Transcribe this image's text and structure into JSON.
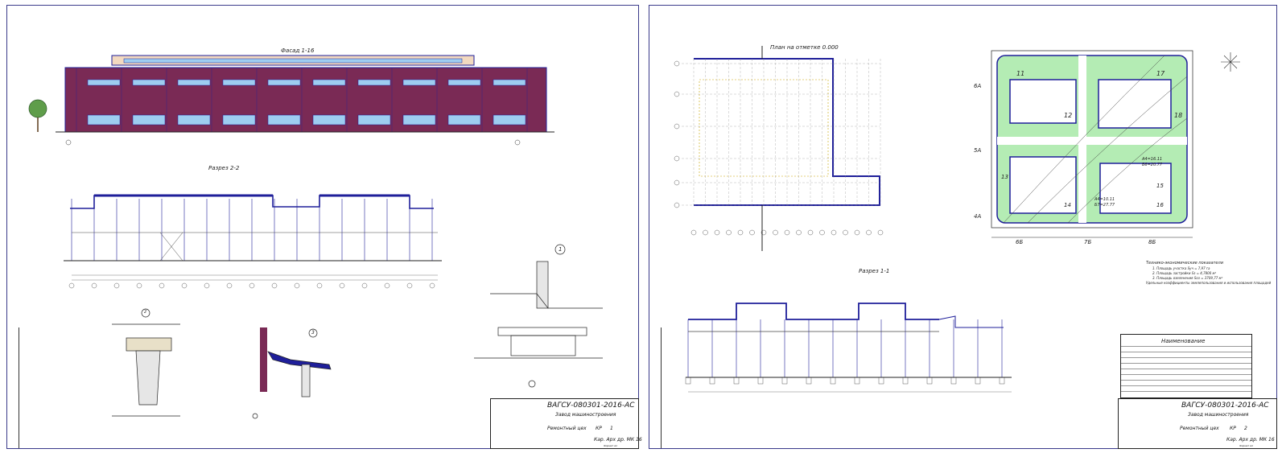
{
  "sheet1": {
    "facade_title": "Фасад 1-16",
    "section_title": "Разрез 2-2",
    "node_labels": [
      "1",
      "2",
      "3"
    ],
    "title_block": {
      "code": "ВАГСУ-080301-2016-АС",
      "project": "Завод машиностроения",
      "name": "Ремонтный цех",
      "stage": "КР",
      "sheet": "1",
      "sheets": "",
      "org": "Кар. Арх др. МК 16",
      "format": "Формат А1"
    }
  },
  "sheet2": {
    "plan_title": "План на отметке 0.000",
    "section_title": "Разрез 1-1",
    "site": {
      "dims": [
        "6Б",
        "7Б",
        "8Б"
      ],
      "axes": [
        "6А",
        "5А",
        "4А"
      ],
      "buildings": [
        "11",
        "17",
        "12",
        "18",
        "13",
        "14",
        "15",
        "16"
      ],
      "marks": [
        "А4=16.11",
        "Б6=20.77",
        "А4=10.11",
        "Б7=27.77"
      ]
    },
    "tep": {
      "title": "Технико-экономические показатели",
      "lines": [
        "1. Площадь участка Sуч = 7,97 га",
        "2. Площадь застройки Sз = 4,7800 м²",
        "3. Площадь озеленения Sоз = 3709,77 м²",
        "Удельные коэффициенты землепользования и использования площадей"
      ]
    },
    "legend": {
      "header": "Наименование",
      "rows": 9
    },
    "title_block": {
      "code": "ВАГСУ-080301-2016-АС",
      "project": "Завод машиностроения",
      "name": "Ремонтный цех",
      "stage": "КР",
      "sheet": "2",
      "org": "Кар. Арх др. МК 16",
      "format": "Формат А1"
    }
  },
  "colors": {
    "frame": "#3a3a8a",
    "brick": "#7a2a55",
    "window": "#9ecdf0",
    "blueline": "#1f1f9a",
    "green": "#b4ecb4"
  }
}
